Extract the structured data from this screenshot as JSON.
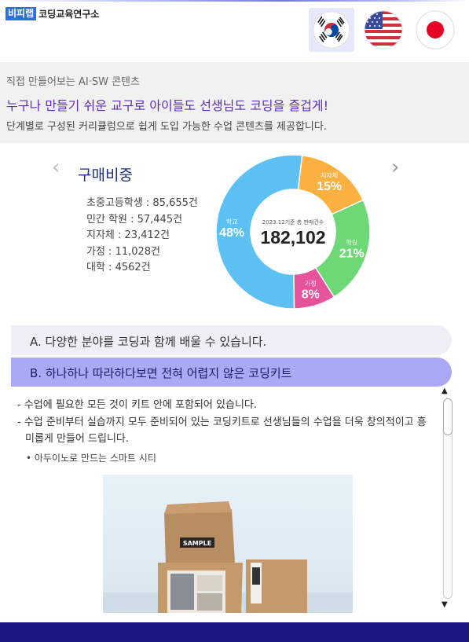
{
  "header": {
    "logo_badge": "비피랩",
    "logo_text": "코딩교육연구소",
    "flags": [
      {
        "name": "korea",
        "active": true
      },
      {
        "name": "usa",
        "active": false
      },
      {
        "name": "japan",
        "active": false
      }
    ]
  },
  "banner": {
    "sub": "직접 만들어보는 AI·SW 콘텐츠",
    "headline": "누구나 만들기 쉬운 교구로 아이들도 선생님도 코딩을 즐겁게!",
    "desc": "단계별로 구성된 커리큘럼으로 쉽게 도입 가능한 수업 콘텐츠를 제공합니다."
  },
  "stats": {
    "title": "구매비중",
    "items": [
      "초중고등학생 : 85,655건",
      "민간 학원 : 57,445건",
      "지자체 : 23,412건",
      "가정 : 11,028건",
      "대학 : 4562건"
    ]
  },
  "chart_data": {
    "type": "pie",
    "center_caption": "2023.12기준 총 판매건수",
    "center_value": "182,102",
    "slices": [
      {
        "label": "지자체",
        "percent": 15,
        "display": "15%",
        "color": "#fbb040"
      },
      {
        "label": "학원",
        "percent": 21,
        "display": "21%",
        "color": "#6fd876"
      },
      {
        "label": "가정",
        "percent": 8,
        "display": "8%",
        "color": "#e5539b"
      },
      {
        "label": "학교",
        "percent": 48,
        "display": "48%",
        "color": "#5cc0f2"
      }
    ]
  },
  "accordion": {
    "a_label": "A. 다양한 분야를 코딩과 함께 배울 수 있습니다.",
    "b_label": "B. 하나하나 따라하다보면 전혀 어렵지 않은 코딩키트"
  },
  "content": {
    "bullets": [
      "- 수업에 필요한 모든 것이 키트 안에 포함되어 있습니다.",
      "- 수업 준비부터 실습까지 모두 준비되어 있는 코딩키트로 선생님들의 수업을 더욱 창의적이고 흥미롭게 만들어 드립니다."
    ],
    "subitem": "• 아두이노로 만드는 스마트 시티",
    "image_label": "SAMPLE",
    "prev_arrow": "‹",
    "next_arrow": "›"
  },
  "colors": {
    "accent_purple": "#5a2fb0",
    "accordion_active": "#a9a9f8",
    "bottom_bar": "#1c1883"
  }
}
